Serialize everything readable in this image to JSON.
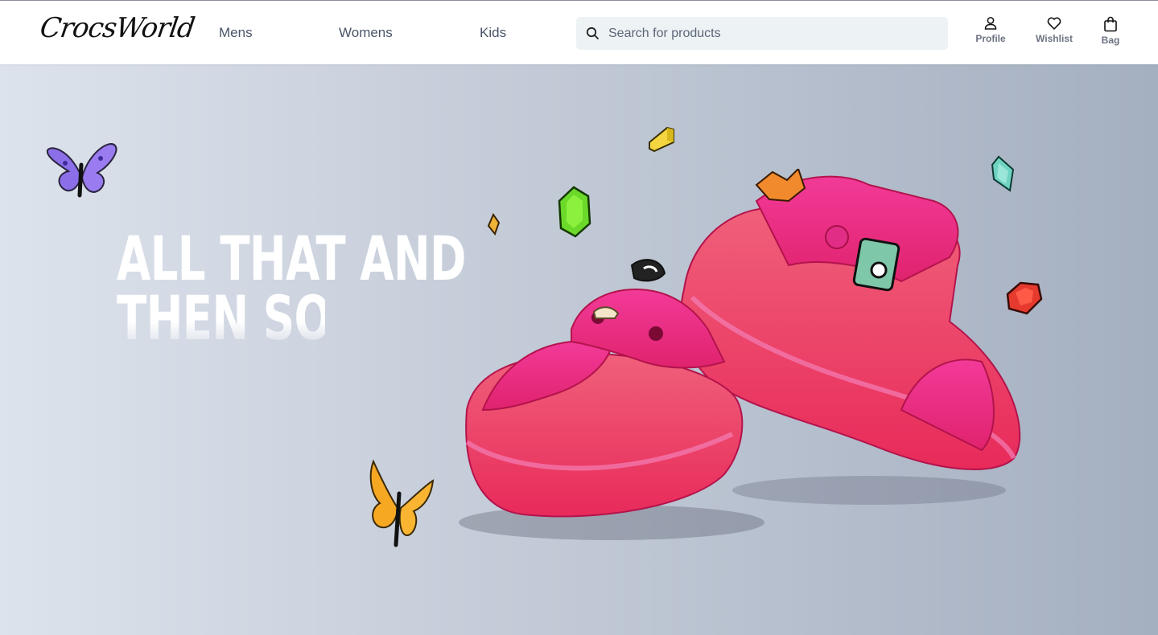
{
  "brand": {
    "logo_text": "CrocsWorld"
  },
  "nav": {
    "links": [
      {
        "label": "Mens"
      },
      {
        "label": "Womens"
      },
      {
        "label": "Kids"
      }
    ]
  },
  "search": {
    "placeholder": "Search for products",
    "value": ""
  },
  "actions": {
    "profile": {
      "label": "Profile",
      "icon": "user-icon"
    },
    "wishlist": {
      "label": "Wishlist",
      "icon": "heart-icon"
    },
    "bag": {
      "label": "Bag",
      "icon": "shopping-bag-icon"
    }
  },
  "hero": {
    "headline_line1": "ALL THAT AND",
    "headline_line2": "THEN SOME",
    "background_colors": [
      "#dde3ec",
      "#a4afc0"
    ],
    "product_color": "#ee2f8c"
  }
}
